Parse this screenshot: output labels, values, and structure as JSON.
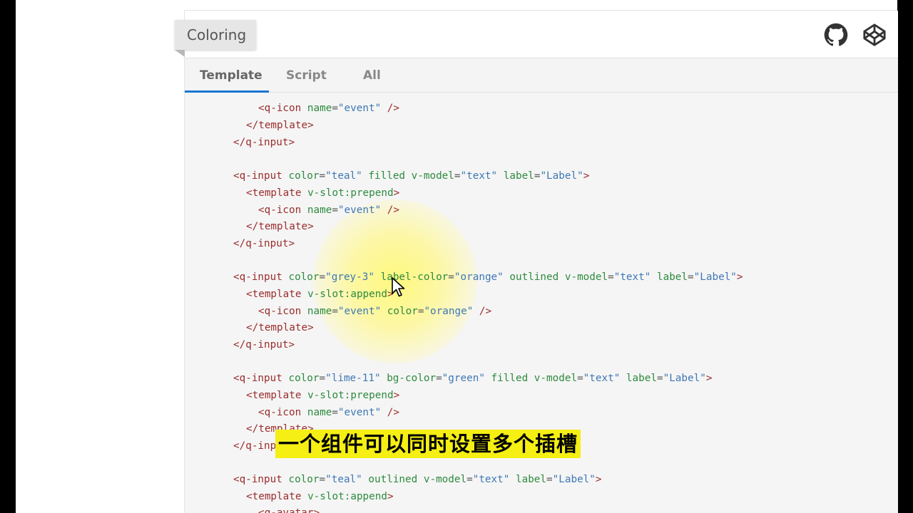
{
  "header": {
    "title": "Coloring",
    "icons": [
      "github-icon",
      "codepen-icon"
    ]
  },
  "tabs": [
    {
      "label": "Template",
      "active": true
    },
    {
      "label": "Script",
      "active": false
    },
    {
      "label": "All",
      "active": false
    }
  ],
  "code": {
    "l1": {
      "t1": "<q-icon ",
      "a1": "name",
      "p1": "=",
      "v1": "\"event\"",
      "t2": " />"
    },
    "l2": {
      "t1": "</template>"
    },
    "l3": {
      "t1": "</q-input>"
    },
    "l5": {
      "t1": "<q-input ",
      "a1": "color",
      "p1": "=",
      "v1": "\"teal\"",
      "a2": " filled v-model",
      "p2": "=",
      "v2": "\"text\"",
      "a3": " label",
      "p3": "=",
      "v3": "\"Label\"",
      "t2": ">"
    },
    "l6": {
      "t1": "<template ",
      "a1": "v-slot:prepend",
      "t2": ">"
    },
    "l7": {
      "t1": "<q-icon ",
      "a1": "name",
      "p1": "=",
      "v1": "\"event\"",
      "t2": " />"
    },
    "l8": {
      "t1": "</template>"
    },
    "l9": {
      "t1": "</q-input>"
    },
    "l11": {
      "t1": "<q-input ",
      "a1": "color",
      "p1": "=",
      "v1": "\"grey-3\"",
      "a2": " label-color",
      "p2": "=",
      "v2": "\"orange\"",
      "a3": " outlined v-model",
      "p3": "=",
      "v3": "\"text\"",
      "a4": " label",
      "p4": "=",
      "v4": "\"Label\"",
      "t2": ">"
    },
    "l12": {
      "t1": "<template ",
      "a1": "v-slot:append",
      "t2": ">"
    },
    "l13": {
      "t1": "<q-icon ",
      "a1": "name",
      "p1": "=",
      "v1": "\"event\"",
      "a2": " color",
      "p2": "=",
      "v2": "\"orange\"",
      "t2": " />"
    },
    "l14": {
      "t1": "</template>"
    },
    "l15": {
      "t1": "</q-input>"
    },
    "l17": {
      "t1": "<q-input ",
      "a1": "color",
      "p1": "=",
      "v1": "\"lime-11\"",
      "a2": " bg-color",
      "p2": "=",
      "v2": "\"green\"",
      "a3": " filled v-model",
      "p3": "=",
      "v3": "\"text\"",
      "a4": " label",
      "p4": "=",
      "v4": "\"Label\"",
      "t2": ">"
    },
    "l18": {
      "t1": "<template ",
      "a1": "v-slot:prepend",
      "t2": ">"
    },
    "l19": {
      "t1": "<q-icon ",
      "a1": "name",
      "p1": "=",
      "v1": "\"event\"",
      "t2": " />"
    },
    "l20": {
      "t1": "</template>"
    },
    "l21": {
      "t1": "</q-inp"
    },
    "l23": {
      "t1": "<q-input ",
      "a1": "color",
      "p1": "=",
      "v1": "\"teal\"",
      "a2": " outlined v-model",
      "p2": "=",
      "v2": "\"text\"",
      "a3": " label",
      "p3": "=",
      "v3": "\"Label\"",
      "t2": ">"
    },
    "l24": {
      "t1": "<template ",
      "a1": "v-slot:append",
      "t2": ">"
    },
    "l25": {
      "t1": "<q-avatar>"
    }
  },
  "subtitle": "一个组件可以同时设置多个插槽",
  "colors": {
    "tab_indicator": "#1976d2",
    "tag": "#9b2d2d",
    "attr": "#2e8a3f",
    "value": "#3e78b5",
    "subtitle_bg": "#f5ef14"
  }
}
